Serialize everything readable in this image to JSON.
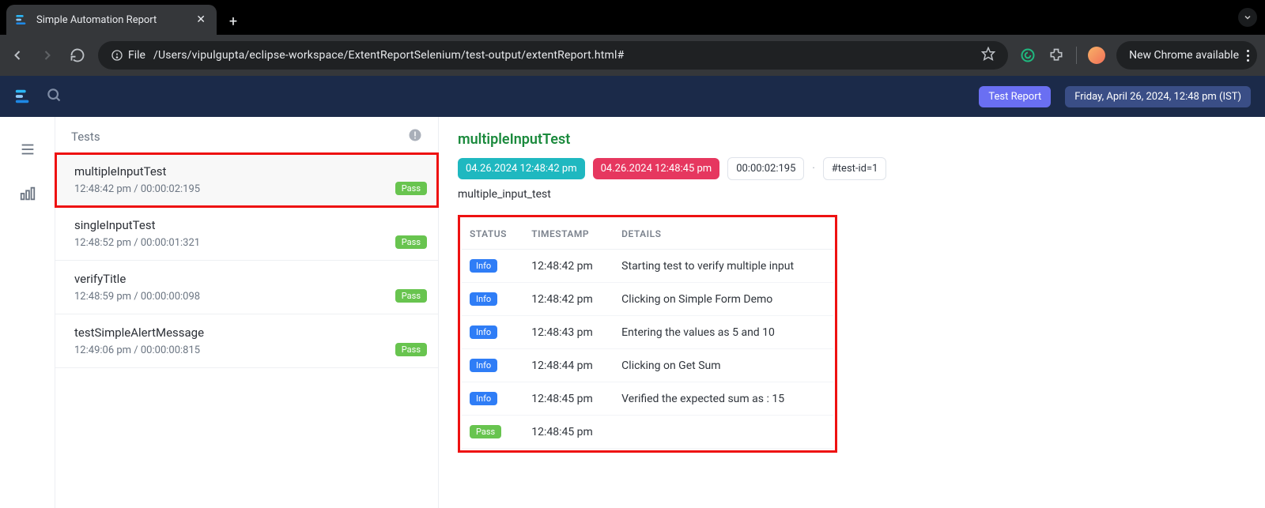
{
  "browser": {
    "tab_title": "Simple Automation Report",
    "new_chrome_label": "New Chrome available",
    "file_label": "File",
    "url": "/Users/vipulgupta/eclipse-workspace/ExtentReportSelenium/test-output/extentReport.html#"
  },
  "header": {
    "test_report_label": "Test Report",
    "datetime_label": "Friday, April 26, 2024, 12:48 pm (IST)"
  },
  "tests_panel": {
    "heading": "Tests",
    "items": [
      {
        "name": "multipleInputTest",
        "meta": "12:48:42 pm / 00:00:02:195",
        "status": "Pass"
      },
      {
        "name": "singleInputTest",
        "meta": "12:48:52 pm / 00:00:01:321",
        "status": "Pass"
      },
      {
        "name": "verifyTitle",
        "meta": "12:48:59 pm / 00:00:00:098",
        "status": "Pass"
      },
      {
        "name": "testSimpleAlertMessage",
        "meta": "12:49:06 pm / 00:00:00:815",
        "status": "Pass"
      }
    ]
  },
  "detail": {
    "title": "multipleInputTest",
    "start_chip": "04.26.2024 12:48:42 pm",
    "end_chip": "04.26.2024 12:48:45 pm",
    "duration_chip": "00:00:02:195",
    "tag_chip": "#test-id=1",
    "subtitle": "multiple_input_test",
    "columns": {
      "status": "STATUS",
      "timestamp": "TIMESTAMP",
      "details": "DETAILS"
    },
    "rows": [
      {
        "status_label": "Info",
        "status_kind": "info",
        "timestamp": "12:48:42 pm",
        "details": "Starting test to verify multiple input"
      },
      {
        "status_label": "Info",
        "status_kind": "info",
        "timestamp": "12:48:42 pm",
        "details": "Clicking on Simple Form Demo"
      },
      {
        "status_label": "Info",
        "status_kind": "info",
        "timestamp": "12:48:43 pm",
        "details": "Entering the values as 5 and 10"
      },
      {
        "status_label": "Info",
        "status_kind": "info",
        "timestamp": "12:48:44 pm",
        "details": "Clicking on Get Sum"
      },
      {
        "status_label": "Info",
        "status_kind": "info",
        "timestamp": "12:48:45 pm",
        "details": "Verified the expected sum as : 15"
      },
      {
        "status_label": "Pass",
        "status_kind": "pass",
        "timestamp": "12:48:45 pm",
        "details": ""
      }
    ]
  }
}
